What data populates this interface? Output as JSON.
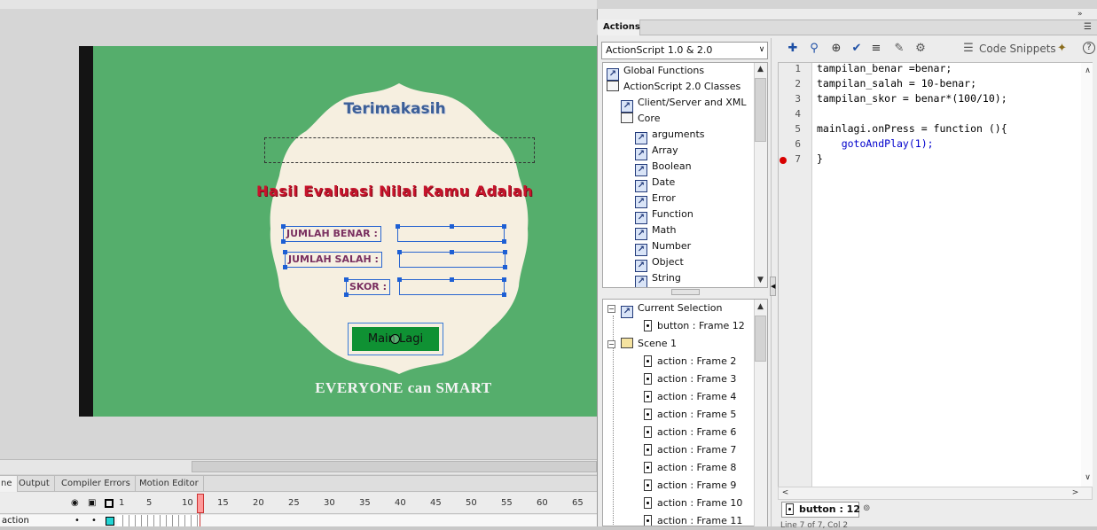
{
  "stage": {
    "thanks_text": "Terimakasih",
    "eval_title": "Hasil Evaluasi Nilai Kamu Adalah",
    "labels": {
      "correct": "JUMLAH BENAR :",
      "wrong": "JUMLAH SALAH :",
      "score": "SKOR :"
    },
    "button_label": "Main Lagi",
    "slogan": "EVERYONE can SMART"
  },
  "timeline": {
    "tabs": [
      "ne",
      "Output",
      "Compiler Errors",
      "Motion Editor"
    ],
    "frame_numbers": [
      "1",
      "5",
      "10",
      "15",
      "20",
      "25",
      "30",
      "35",
      "40",
      "45",
      "50",
      "55",
      "60",
      "65"
    ],
    "layer_name": "action"
  },
  "actions_panel": {
    "title": "Actions",
    "version": "ActionScript 1.0 & 2.0",
    "tree_top": [
      {
        "label": "Global Functions",
        "indent": 0,
        "icon": "book"
      },
      {
        "label": "ActionScript 2.0 Classes",
        "indent": 0,
        "icon": "book"
      },
      {
        "label": "Client/Server and XML",
        "indent": 1,
        "icon": "book"
      },
      {
        "label": "Core",
        "indent": 1,
        "icon": "book-open"
      },
      {
        "label": "arguments",
        "indent": 2,
        "icon": "class"
      },
      {
        "label": "Array",
        "indent": 2,
        "icon": "class"
      },
      {
        "label": "Boolean",
        "indent": 2,
        "icon": "class"
      },
      {
        "label": "Date",
        "indent": 2,
        "icon": "class"
      },
      {
        "label": "Error",
        "indent": 2,
        "icon": "class"
      },
      {
        "label": "Function",
        "indent": 2,
        "icon": "class"
      },
      {
        "label": "Math",
        "indent": 2,
        "icon": "class"
      },
      {
        "label": "Number",
        "indent": 2,
        "icon": "class"
      },
      {
        "label": "Object",
        "indent": 2,
        "icon": "class"
      },
      {
        "label": "String",
        "indent": 2,
        "icon": "class"
      }
    ],
    "tree_bottom": {
      "current_selection": "Current Selection",
      "selection_item": "button : Frame 12",
      "scene": "Scene 1",
      "frames": [
        "action : Frame 2",
        "action : Frame 3",
        "action : Frame 4",
        "action : Frame 5",
        "action : Frame 6",
        "action : Frame 7",
        "action : Frame 8",
        "action : Frame 9",
        "action : Frame 10",
        "action : Frame 11"
      ]
    },
    "toolbar": {
      "code_snippets": "Code Snippets",
      "help": "?"
    },
    "code_lines": [
      {
        "n": "1",
        "text": "tampilan_benar =benar;"
      },
      {
        "n": "2",
        "text": "tampilan_salah = 10-benar;"
      },
      {
        "n": "3",
        "text": "tampilan_skor = benar*(100/10);"
      },
      {
        "n": "4",
        "text": ""
      },
      {
        "n": "5",
        "text": "mainlagi.onPress = function (){"
      },
      {
        "n": "6",
        "text": "    gotoAndPlay(1);"
      },
      {
        "n": "7",
        "text": "}"
      }
    ],
    "file_tab": "button : 12",
    "status_hint": "Line 7 of 7, Col 2"
  }
}
